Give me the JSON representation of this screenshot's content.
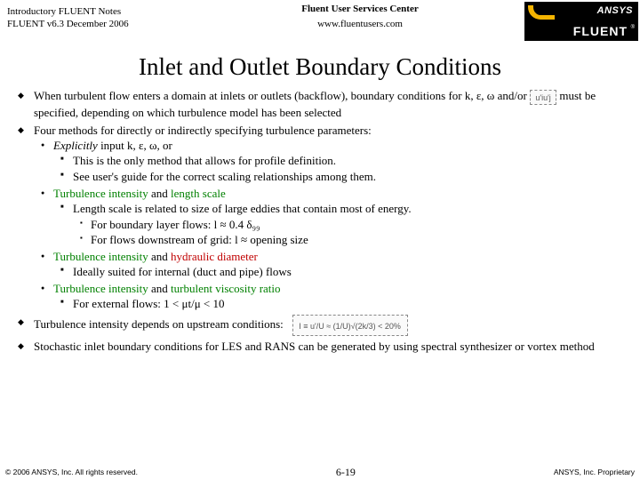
{
  "header": {
    "left1": "Introductory FLUENT Notes",
    "left2": "FLUENT v6.3 December 2006",
    "center1": "Fluent User Services Center",
    "center2": "www.fluentusers.com",
    "logo_top": "ANSYS",
    "logo_bottom": "FLUENT",
    "logo_reg": "®"
  },
  "title": "Inlet and Outlet Boundary Conditions",
  "b1a": "When turbulent flow enters a domain at inlets or outlets (backflow), boundary conditions for k, ε, ω and/or ",
  "b1b": " must be specified, depending on which turbulence model has been selected",
  "eq1": "u'iu'j",
  "b2": "Four methods for directly or indirectly specifying turbulence parameters:",
  "m1_i": "Explicitly",
  "m1_r": " input k, ε, ω, or",
  "m1s1": "This is the only method that allows for profile definition.",
  "m1s2": "See user's guide for the correct scaling relationships among them.",
  "m2a": "Turbulence intensity",
  "m2b": " and ",
  "m2c": "length scale",
  "m2s1": "Length scale is related to size of large eddies that contain most of energy.",
  "m2s1a": "For boundary layer flows:   l ≈ 0.4 δ₉₉",
  "m2s1b": "For flows downstream of grid:   l ≈ opening size",
  "m3a": "Turbulence intensity",
  "m3b": " and ",
  "m3c": "hydraulic diameter",
  "m3s1": "Ideally suited for internal (duct and pipe) flows",
  "m4a": "Turbulence intensity",
  "m4b": " and ",
  "m4c": "turbulent viscosity ratio",
  "m4s1a": "For external flows:   ",
  "m4s1b": "1 < μt/μ < 10",
  "b3": "Turbulence intensity depends on upstream conditions:",
  "eq2": "I ≡ u'/U ≈ (1/U)√(2k/3) < 20%",
  "b4": "Stochastic inlet boundary conditions for LES and RANS can be generated by using spectral synthesizer or vortex method",
  "footer": {
    "left": "© 2006 ANSYS, Inc. All rights reserved.",
    "center": "6-19",
    "right": "ANSYS, Inc. Proprietary"
  }
}
